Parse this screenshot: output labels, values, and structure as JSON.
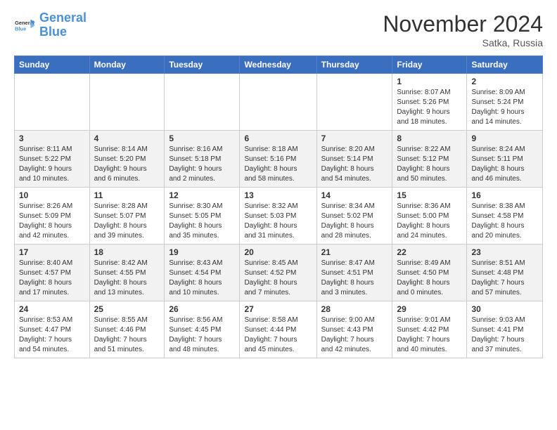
{
  "logo": {
    "line1": "General",
    "line2": "Blue"
  },
  "title": "November 2024",
  "subtitle": "Satka, Russia",
  "weekdays": [
    "Sunday",
    "Monday",
    "Tuesday",
    "Wednesday",
    "Thursday",
    "Friday",
    "Saturday"
  ],
  "weeks": [
    [
      {
        "day": "",
        "info": ""
      },
      {
        "day": "",
        "info": ""
      },
      {
        "day": "",
        "info": ""
      },
      {
        "day": "",
        "info": ""
      },
      {
        "day": "",
        "info": ""
      },
      {
        "day": "1",
        "info": "Sunrise: 8:07 AM\nSunset: 5:26 PM\nDaylight: 9 hours\nand 18 minutes."
      },
      {
        "day": "2",
        "info": "Sunrise: 8:09 AM\nSunset: 5:24 PM\nDaylight: 9 hours\nand 14 minutes."
      }
    ],
    [
      {
        "day": "3",
        "info": "Sunrise: 8:11 AM\nSunset: 5:22 PM\nDaylight: 9 hours\nand 10 minutes."
      },
      {
        "day": "4",
        "info": "Sunrise: 8:14 AM\nSunset: 5:20 PM\nDaylight: 9 hours\nand 6 minutes."
      },
      {
        "day": "5",
        "info": "Sunrise: 8:16 AM\nSunset: 5:18 PM\nDaylight: 9 hours\nand 2 minutes."
      },
      {
        "day": "6",
        "info": "Sunrise: 8:18 AM\nSunset: 5:16 PM\nDaylight: 8 hours\nand 58 minutes."
      },
      {
        "day": "7",
        "info": "Sunrise: 8:20 AM\nSunset: 5:14 PM\nDaylight: 8 hours\nand 54 minutes."
      },
      {
        "day": "8",
        "info": "Sunrise: 8:22 AM\nSunset: 5:12 PM\nDaylight: 8 hours\nand 50 minutes."
      },
      {
        "day": "9",
        "info": "Sunrise: 8:24 AM\nSunset: 5:11 PM\nDaylight: 8 hours\nand 46 minutes."
      }
    ],
    [
      {
        "day": "10",
        "info": "Sunrise: 8:26 AM\nSunset: 5:09 PM\nDaylight: 8 hours\nand 42 minutes."
      },
      {
        "day": "11",
        "info": "Sunrise: 8:28 AM\nSunset: 5:07 PM\nDaylight: 8 hours\nand 39 minutes."
      },
      {
        "day": "12",
        "info": "Sunrise: 8:30 AM\nSunset: 5:05 PM\nDaylight: 8 hours\nand 35 minutes."
      },
      {
        "day": "13",
        "info": "Sunrise: 8:32 AM\nSunset: 5:03 PM\nDaylight: 8 hours\nand 31 minutes."
      },
      {
        "day": "14",
        "info": "Sunrise: 8:34 AM\nSunset: 5:02 PM\nDaylight: 8 hours\nand 28 minutes."
      },
      {
        "day": "15",
        "info": "Sunrise: 8:36 AM\nSunset: 5:00 PM\nDaylight: 8 hours\nand 24 minutes."
      },
      {
        "day": "16",
        "info": "Sunrise: 8:38 AM\nSunset: 4:58 PM\nDaylight: 8 hours\nand 20 minutes."
      }
    ],
    [
      {
        "day": "17",
        "info": "Sunrise: 8:40 AM\nSunset: 4:57 PM\nDaylight: 8 hours\nand 17 minutes."
      },
      {
        "day": "18",
        "info": "Sunrise: 8:42 AM\nSunset: 4:55 PM\nDaylight: 8 hours\nand 13 minutes."
      },
      {
        "day": "19",
        "info": "Sunrise: 8:43 AM\nSunset: 4:54 PM\nDaylight: 8 hours\nand 10 minutes."
      },
      {
        "day": "20",
        "info": "Sunrise: 8:45 AM\nSunset: 4:52 PM\nDaylight: 8 hours\nand 7 minutes."
      },
      {
        "day": "21",
        "info": "Sunrise: 8:47 AM\nSunset: 4:51 PM\nDaylight: 8 hours\nand 3 minutes."
      },
      {
        "day": "22",
        "info": "Sunrise: 8:49 AM\nSunset: 4:50 PM\nDaylight: 8 hours\nand 0 minutes."
      },
      {
        "day": "23",
        "info": "Sunrise: 8:51 AM\nSunset: 4:48 PM\nDaylight: 7 hours\nand 57 minutes."
      }
    ],
    [
      {
        "day": "24",
        "info": "Sunrise: 8:53 AM\nSunset: 4:47 PM\nDaylight: 7 hours\nand 54 minutes."
      },
      {
        "day": "25",
        "info": "Sunrise: 8:55 AM\nSunset: 4:46 PM\nDaylight: 7 hours\nand 51 minutes."
      },
      {
        "day": "26",
        "info": "Sunrise: 8:56 AM\nSunset: 4:45 PM\nDaylight: 7 hours\nand 48 minutes."
      },
      {
        "day": "27",
        "info": "Sunrise: 8:58 AM\nSunset: 4:44 PM\nDaylight: 7 hours\nand 45 minutes."
      },
      {
        "day": "28",
        "info": "Sunrise: 9:00 AM\nSunset: 4:43 PM\nDaylight: 7 hours\nand 42 minutes."
      },
      {
        "day": "29",
        "info": "Sunrise: 9:01 AM\nSunset: 4:42 PM\nDaylight: 7 hours\nand 40 minutes."
      },
      {
        "day": "30",
        "info": "Sunrise: 9:03 AM\nSunset: 4:41 PM\nDaylight: 7 hours\nand 37 minutes."
      }
    ]
  ]
}
